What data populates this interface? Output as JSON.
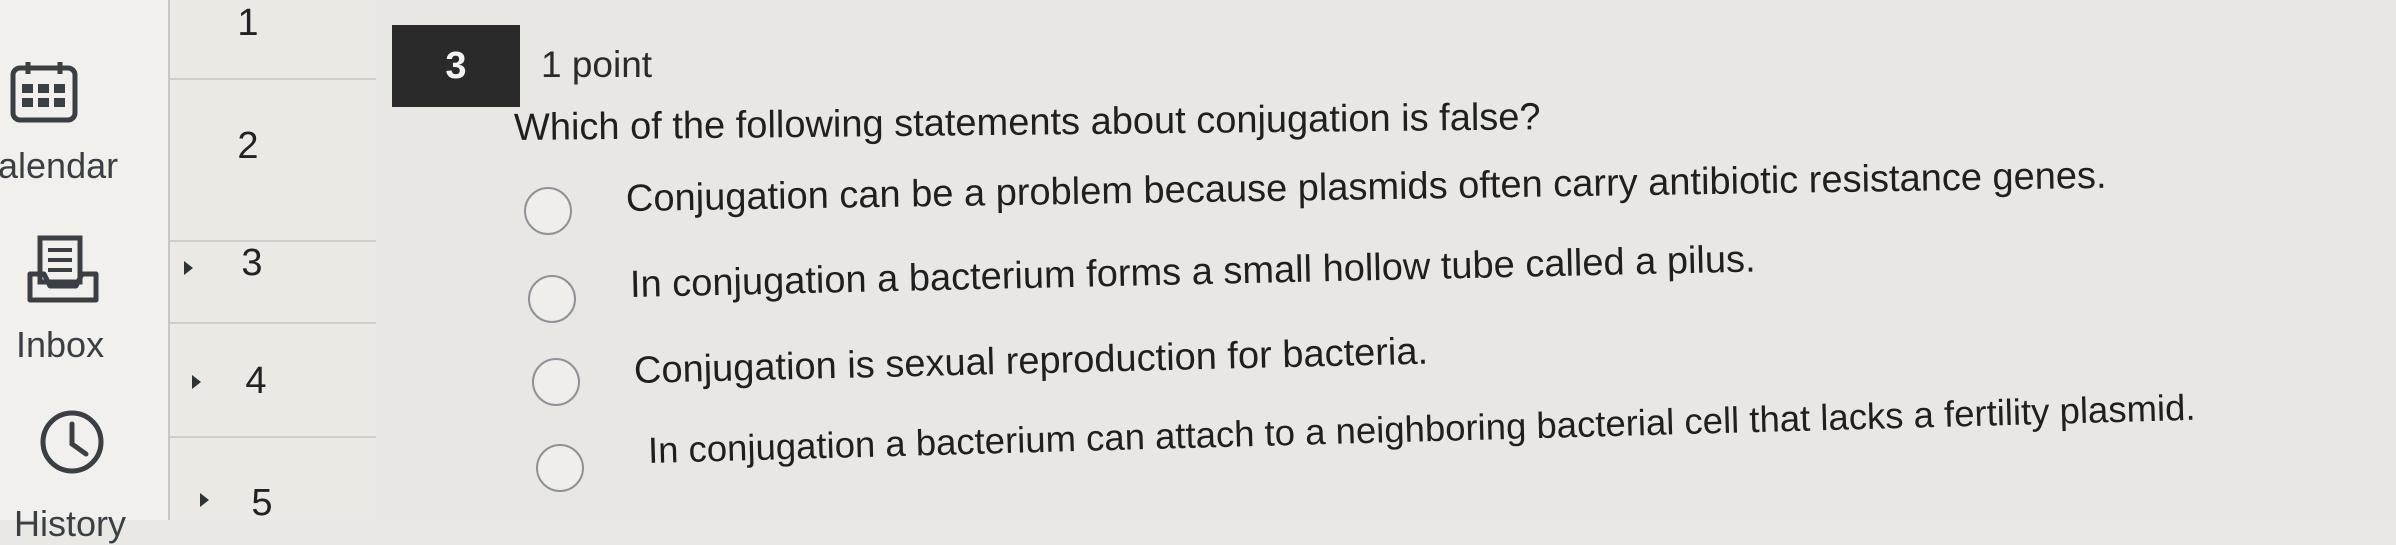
{
  "global_nav": {
    "items": [
      {
        "key": "calendar",
        "label": "alendar",
        "icon": "calendar-icon"
      },
      {
        "key": "inbox",
        "label": "Inbox",
        "icon": "inbox-icon"
      },
      {
        "key": "history",
        "label": "History",
        "icon": "clock-icon"
      }
    ]
  },
  "question_nav": {
    "numbers": [
      "1",
      "2",
      "3",
      "4",
      "5"
    ]
  },
  "question": {
    "number": "3",
    "points": "1 point",
    "prompt": "Which of the following statements about conjugation is false?",
    "answers": [
      "Conjugation can be a problem because plasmids often carry antibiotic resistance genes.",
      "In conjugation a bacterium forms a small hollow tube called a pilus.",
      "Conjugation is sexual reproduction for bacteria.",
      "In conjugation a bacterium can attach to a neighboring bacterial cell that lacks a fertility plasmid."
    ]
  },
  "colors": {
    "badge_bg": "#2a2a2a",
    "nav_bg": "#f1f0ec",
    "radio_border": "#8f9296"
  }
}
